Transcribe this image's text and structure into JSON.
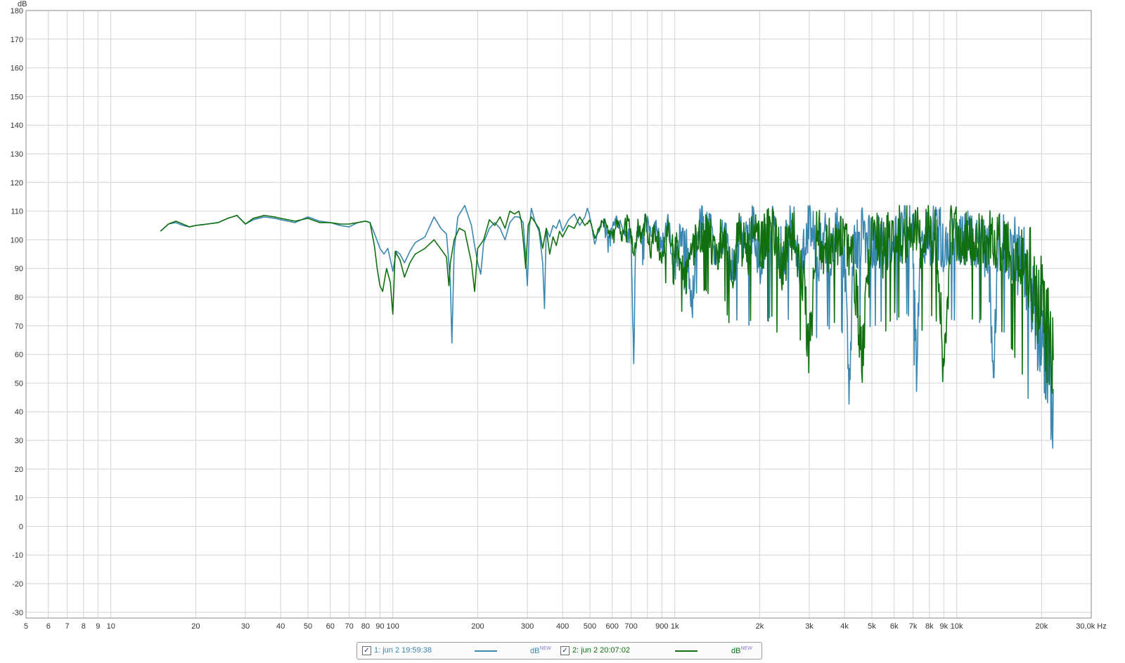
{
  "chart_data": {
    "type": "line",
    "x_scale": "log",
    "xlim": [
      5,
      30000
    ],
    "ylim": [
      -32,
      180
    ],
    "grid": true,
    "y_unit": "dB",
    "x_unit": "Hz",
    "y_ticks": [
      180,
      170,
      160,
      150,
      140,
      130,
      120,
      110,
      100,
      90,
      80,
      70,
      60,
      50,
      40,
      30,
      20,
      10,
      0,
      -10,
      -20,
      -30
    ],
    "x_ticks": [
      {
        "v": 5,
        "label": "5"
      },
      {
        "v": 6,
        "label": "6"
      },
      {
        "v": 7,
        "label": "7"
      },
      {
        "v": 8,
        "label": "8"
      },
      {
        "v": 9,
        "label": "9"
      },
      {
        "v": 10,
        "label": "10"
      },
      {
        "v": 20,
        "label": "20"
      },
      {
        "v": 30,
        "label": "30"
      },
      {
        "v": 40,
        "label": "40"
      },
      {
        "v": 50,
        "label": "50"
      },
      {
        "v": 60,
        "label": "60"
      },
      {
        "v": 70,
        "label": "70"
      },
      {
        "v": 80,
        "label": "80"
      },
      {
        "v": 90,
        "label": "90"
      },
      {
        "v": 100,
        "label": "100"
      },
      {
        "v": 200,
        "label": "200"
      },
      {
        "v": 300,
        "label": "300"
      },
      {
        "v": 400,
        "label": "400"
      },
      {
        "v": 500,
        "label": "500"
      },
      {
        "v": 600,
        "label": "600"
      },
      {
        "v": 700,
        "label": "700"
      },
      {
        "v": 900,
        "label": "900"
      },
      {
        "v": 1000,
        "label": "1k"
      },
      {
        "v": 2000,
        "label": "2k"
      },
      {
        "v": 3000,
        "label": "3k"
      },
      {
        "v": 4000,
        "label": "4k"
      },
      {
        "v": 5000,
        "label": "5k"
      },
      {
        "v": 6000,
        "label": "6k"
      },
      {
        "v": 7000,
        "label": "7k"
      },
      {
        "v": 8000,
        "label": "8k"
      },
      {
        "v": 9000,
        "label": "9k"
      },
      {
        "v": 10000,
        "label": "10k"
      },
      {
        "v": 20000,
        "label": "20k"
      },
      {
        "v": 30000,
        "label": "30,0k"
      }
    ],
    "x_grid_minor": [
      800
    ],
    "series": [
      {
        "name": "1: jun 2 19:59:38",
        "color": "#3a87b0",
        "points": [
          [
            15,
            103
          ],
          [
            16,
            105.5
          ],
          [
            17,
            106
          ],
          [
            18,
            105
          ],
          [
            19,
            104.5
          ],
          [
            20,
            105
          ],
          [
            22,
            105.5
          ],
          [
            24,
            106
          ],
          [
            26,
            107.5
          ],
          [
            28,
            108.5
          ],
          [
            30,
            105.5
          ],
          [
            32,
            107
          ],
          [
            35,
            108
          ],
          [
            38,
            107.5
          ],
          [
            40,
            107
          ],
          [
            45,
            106
          ],
          [
            50,
            108
          ],
          [
            55,
            106.5
          ],
          [
            60,
            106
          ],
          [
            65,
            105
          ],
          [
            70,
            104.5
          ],
          [
            75,
            106
          ],
          [
            80,
            106.5
          ],
          [
            83,
            106
          ],
          [
            87,
            101
          ],
          [
            90,
            97
          ],
          [
            93,
            95
          ],
          [
            96,
            97
          ],
          [
            98,
            93
          ],
          [
            100,
            89
          ],
          [
            103,
            96
          ],
          [
            106,
            95
          ],
          [
            110,
            92
          ],
          [
            115,
            96
          ],
          [
            120,
            99
          ],
          [
            130,
            101
          ],
          [
            140,
            108
          ],
          [
            148,
            104
          ],
          [
            155,
            102
          ],
          [
            160,
            85
          ],
          [
            162,
            64
          ],
          [
            165,
            96
          ],
          [
            170,
            108
          ],
          [
            180,
            112
          ],
          [
            190,
            105
          ],
          [
            195,
            98
          ],
          [
            200,
            92
          ],
          [
            205,
            88
          ],
          [
            210,
            99
          ],
          [
            220,
            104
          ],
          [
            230,
            106
          ],
          [
            240,
            104
          ],
          [
            250,
            100
          ],
          [
            260,
            106
          ],
          [
            270,
            108
          ],
          [
            280,
            108
          ],
          [
            290,
            106
          ],
          [
            295,
            96
          ],
          [
            300,
            84
          ],
          [
            305,
            104
          ],
          [
            310,
            111
          ],
          [
            320,
            106
          ],
          [
            330,
            103
          ],
          [
            340,
            92
          ],
          [
            345,
            76
          ],
          [
            350,
            104
          ],
          [
            360,
            101
          ],
          [
            370,
            105
          ],
          [
            380,
            104
          ],
          [
            390,
            107
          ],
          [
            400,
            103
          ],
          [
            420,
            107
          ],
          [
            440,
            109
          ],
          [
            460,
            105
          ],
          [
            480,
            108
          ],
          [
            490,
            111
          ],
          [
            500,
            108
          ],
          [
            520,
            99
          ],
          [
            540,
            104
          ],
          [
            560,
            107
          ],
          [
            580,
            100
          ],
          [
            600,
            105
          ],
          [
            620,
            108
          ],
          [
            650,
            104
          ],
          [
            680,
            101
          ],
          [
            700,
            104
          ],
          [
            715,
            56
          ],
          [
            725,
            97
          ],
          [
            740,
            104
          ],
          [
            760,
            99
          ],
          [
            790,
            108
          ],
          [
            820,
            101
          ],
          [
            850,
            106
          ],
          [
            900,
            99
          ],
          [
            950,
            106
          ],
          [
            1000,
            91
          ],
          [
            1050,
            104
          ],
          [
            1100,
            99
          ],
          [
            1150,
            77
          ],
          [
            1200,
            105
          ],
          [
            1300,
            108
          ],
          [
            1400,
            97
          ],
          [
            1500,
            107
          ],
          [
            1600,
            91
          ],
          [
            1700,
            105
          ],
          [
            1800,
            98
          ],
          [
            1900,
            106
          ],
          [
            2000,
            94
          ],
          [
            2200,
            106
          ],
          [
            2400,
            97
          ],
          [
            2600,
            107
          ],
          [
            2800,
            95
          ],
          [
            3000,
            108
          ],
          [
            3200,
            96
          ],
          [
            3400,
            102
          ],
          [
            3600,
            99
          ],
          [
            3800,
            104
          ],
          [
            4000,
            96
          ],
          [
            4150,
            47
          ],
          [
            4300,
            101
          ],
          [
            4600,
            103
          ],
          [
            5000,
            100
          ],
          [
            5500,
            104
          ],
          [
            6000,
            101
          ],
          [
            6500,
            107
          ],
          [
            7000,
            102
          ],
          [
            7200,
            57
          ],
          [
            7500,
            105
          ],
          [
            8000,
            103
          ],
          [
            8500,
            106
          ],
          [
            9000,
            101
          ],
          [
            9500,
            104
          ],
          [
            10000,
            102
          ],
          [
            11000,
            103
          ],
          [
            12000,
            102
          ],
          [
            13000,
            97
          ],
          [
            13500,
            46
          ],
          [
            14000,
            103
          ],
          [
            15000,
            101
          ],
          [
            16000,
            98
          ],
          [
            17000,
            96
          ],
          [
            18000,
            90
          ],
          [
            19000,
            78
          ],
          [
            20000,
            70
          ],
          [
            21000,
            60
          ],
          [
            22000,
            48
          ]
        ]
      },
      {
        "name": "2: jun 2 20:07:02",
        "color": "#107010",
        "points": [
          [
            15,
            103
          ],
          [
            16,
            105.5
          ],
          [
            17,
            106.5
          ],
          [
            18,
            105.5
          ],
          [
            19,
            104.5
          ],
          [
            20,
            105
          ],
          [
            22,
            105.5
          ],
          [
            24,
            106
          ],
          [
            26,
            107.5
          ],
          [
            28,
            108.5
          ],
          [
            30,
            105.5
          ],
          [
            32,
            107.5
          ],
          [
            35,
            108.5
          ],
          [
            38,
            108
          ],
          [
            40,
            107.5
          ],
          [
            45,
            106.5
          ],
          [
            50,
            107.5
          ],
          [
            55,
            106
          ],
          [
            60,
            106
          ],
          [
            65,
            105.5
          ],
          [
            70,
            105.5
          ],
          [
            75,
            106
          ],
          [
            80,
            106.5
          ],
          [
            83,
            106
          ],
          [
            86,
            98
          ],
          [
            88,
            90
          ],
          [
            90,
            84
          ],
          [
            92,
            82
          ],
          [
            95,
            90
          ],
          [
            98,
            85
          ],
          [
            100,
            74
          ],
          [
            102,
            96
          ],
          [
            106,
            93
          ],
          [
            110,
            87
          ],
          [
            115,
            92
          ],
          [
            120,
            95
          ],
          [
            130,
            97
          ],
          [
            140,
            100
          ],
          [
            150,
            96
          ],
          [
            155,
            94
          ],
          [
            158,
            84
          ],
          [
            160,
            92
          ],
          [
            165,
            100
          ],
          [
            172,
            104
          ],
          [
            180,
            103
          ],
          [
            190,
            92
          ],
          [
            195,
            82
          ],
          [
            200,
            97
          ],
          [
            210,
            100
          ],
          [
            220,
            107
          ],
          [
            230,
            105
          ],
          [
            240,
            108
          ],
          [
            250,
            104
          ],
          [
            260,
            110
          ],
          [
            270,
            109
          ],
          [
            280,
            110
          ],
          [
            285,
            107
          ],
          [
            290,
            100
          ],
          [
            296,
            90
          ],
          [
            302,
            105
          ],
          [
            310,
            108
          ],
          [
            320,
            106
          ],
          [
            330,
            104
          ],
          [
            340,
            97
          ],
          [
            350,
            104
          ],
          [
            360,
            95
          ],
          [
            370,
            101
          ],
          [
            380,
            98
          ],
          [
            390,
            103
          ],
          [
            400,
            101
          ],
          [
            420,
            105
          ],
          [
            440,
            104
          ],
          [
            460,
            108
          ],
          [
            480,
            105
          ],
          [
            500,
            107
          ],
          [
            520,
            101
          ],
          [
            540,
            104
          ],
          [
            560,
            108
          ],
          [
            580,
            103
          ],
          [
            600,
            102
          ],
          [
            620,
            107
          ],
          [
            650,
            102
          ],
          [
            680,
            108
          ],
          [
            700,
            102
          ],
          [
            720,
            96
          ],
          [
            740,
            105
          ],
          [
            760,
            101
          ],
          [
            790,
            107
          ],
          [
            820,
            97
          ],
          [
            850,
            105
          ],
          [
            900,
            94
          ],
          [
            950,
            104
          ],
          [
            1000,
            100
          ],
          [
            1100,
            88
          ],
          [
            1200,
            102
          ],
          [
            1300,
            105
          ],
          [
            1400,
            96
          ],
          [
            1500,
            105
          ],
          [
            1600,
            92
          ],
          [
            1700,
            104
          ],
          [
            1800,
            96
          ],
          [
            1900,
            106
          ],
          [
            2000,
            98
          ],
          [
            2200,
            105
          ],
          [
            2400,
            93
          ],
          [
            2600,
            105
          ],
          [
            2800,
            96
          ],
          [
            3000,
            63
          ],
          [
            3200,
            106
          ],
          [
            3400,
            98
          ],
          [
            3600,
            103
          ],
          [
            3800,
            100
          ],
          [
            4000,
            105
          ],
          [
            4300,
            95
          ],
          [
            4600,
            59
          ],
          [
            5000,
            104
          ],
          [
            5500,
            98
          ],
          [
            6000,
            106
          ],
          [
            6500,
            102
          ],
          [
            7000,
            108
          ],
          [
            7500,
            99
          ],
          [
            8000,
            105
          ],
          [
            8500,
            103
          ],
          [
            9000,
            53
          ],
          [
            9500,
            105
          ],
          [
            10000,
            104
          ],
          [
            11000,
            103
          ],
          [
            12000,
            104
          ],
          [
            13000,
            102
          ],
          [
            14000,
            101
          ],
          [
            15000,
            100
          ],
          [
            16000,
            99
          ],
          [
            17000,
            96
          ],
          [
            18000,
            93
          ],
          [
            19000,
            87
          ],
          [
            20000,
            80
          ],
          [
            21000,
            72
          ],
          [
            22000,
            58
          ]
        ]
      }
    ]
  },
  "axis_labels": {
    "y_unit": "dB",
    "x_last": "30,0k Hz"
  },
  "legend": {
    "items": [
      {
        "checked": true,
        "check_glyph": "✓",
        "name": "1: jun 2 19:59:38",
        "color": "#3a87b0",
        "unit": "dB",
        "unit_sup": "NEW"
      },
      {
        "checked": true,
        "check_glyph": "✓",
        "name": "2: jun 2 20:07:02",
        "color": "#107010",
        "unit": "dB",
        "unit_sup": "NEW"
      }
    ]
  }
}
